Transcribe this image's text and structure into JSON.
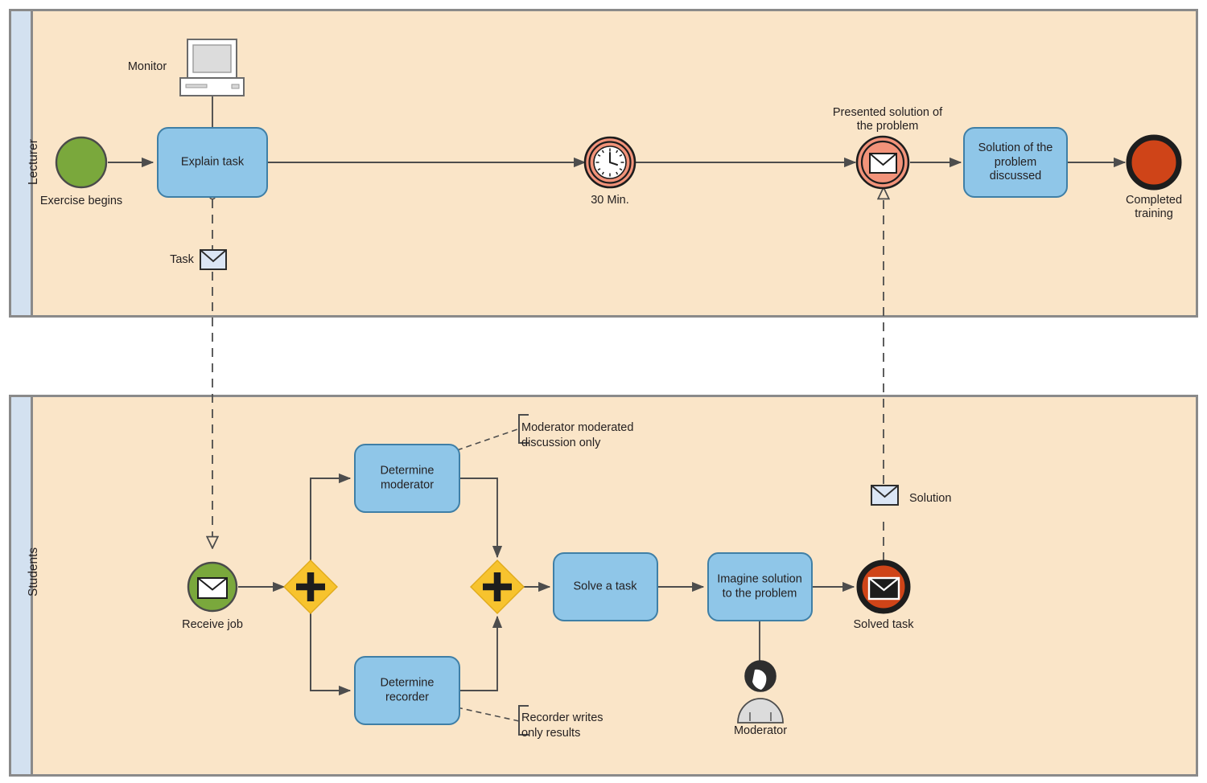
{
  "diagram": {
    "type": "BPMN cross-functional swimlane diagram",
    "colors": {
      "lane_header_fill": "#d3e1f0",
      "lane_body_fill": "#fae5c8",
      "lane_border": "#8a8a8a",
      "task_fill": "#8fc6e8",
      "task_border": "#3f7fa6",
      "start_event_fill": "#7aa83c",
      "end_event_fill": "#cf4418",
      "intermediate_fill": "#f2937a",
      "gateway_fill": "#f7c32e",
      "flow_line": "#4d4d4d",
      "envelope_fill": "#dbe6f5",
      "person_fill": "#dcdcdc"
    }
  },
  "lanes": [
    {
      "id": "lecturer",
      "label": "Lecturer"
    },
    {
      "id": "students",
      "label": "Students"
    }
  ],
  "lecturer": {
    "artifacts": [
      {
        "id": "monitor",
        "label": "Monitor",
        "icon": "monitor-icon"
      },
      {
        "id": "task-message",
        "label": "Task",
        "icon": "envelope-icon"
      }
    ],
    "nodes": [
      {
        "id": "exercise-begins",
        "label": "Exercise begins",
        "type": "start-event"
      },
      {
        "id": "explain-task",
        "label": "Explain task",
        "type": "task"
      },
      {
        "id": "timer-30min",
        "label": "30 Min.",
        "type": "intermediate-timer-event"
      },
      {
        "id": "presented-solution",
        "label": "Presented solution of\nthe problem",
        "type": "intermediate-message-event"
      },
      {
        "id": "solution-discussed",
        "label": "Solution of the\nproblem\ndiscussed",
        "type": "task"
      },
      {
        "id": "completed-training",
        "label": "Completed\ntraining",
        "type": "end-event"
      }
    ]
  },
  "students": {
    "artifacts": [
      {
        "id": "solution-message",
        "label": "Solution",
        "icon": "envelope-icon"
      },
      {
        "id": "moderator-role",
        "label": "Moderator",
        "icon": "person-icon"
      }
    ],
    "annotations": [
      {
        "id": "anno-moderator",
        "text": "Moderator moderated\ndiscussion only"
      },
      {
        "id": "anno-recorder",
        "text": "Recorder writes\nonly results"
      }
    ],
    "nodes": [
      {
        "id": "receive-job",
        "label": "Receive job",
        "type": "start-message-event"
      },
      {
        "id": "gateway-split",
        "label": "+",
        "type": "parallel-gateway"
      },
      {
        "id": "determine-moderator",
        "label": "Determine\nmoderator",
        "type": "task"
      },
      {
        "id": "determine-recorder",
        "label": "Determine\nrecorder",
        "type": "task"
      },
      {
        "id": "gateway-join",
        "label": "+",
        "type": "parallel-gateway"
      },
      {
        "id": "solve-a-task",
        "label": "Solve a task",
        "type": "task"
      },
      {
        "id": "imagine-solution",
        "label": "Imagine solution\nto the problem",
        "type": "task"
      },
      {
        "id": "solved-task",
        "label": "Solved task",
        "type": "end-message-event"
      }
    ]
  }
}
